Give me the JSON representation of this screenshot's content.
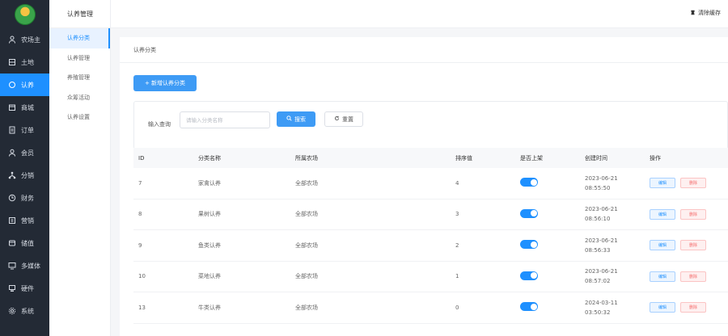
{
  "sidebar": {
    "items": [
      {
        "label": "农场主",
        "icon": "farmer-icon",
        "active": false
      },
      {
        "label": "土地",
        "icon": "land-icon",
        "active": false
      },
      {
        "label": "认养",
        "icon": "adopt-icon",
        "active": true
      },
      {
        "label": "商城",
        "icon": "mall-icon",
        "active": false
      },
      {
        "label": "订单",
        "icon": "order-icon",
        "active": false
      },
      {
        "label": "会员",
        "icon": "member-icon",
        "active": false
      },
      {
        "label": "分销",
        "icon": "distribution-icon",
        "active": false
      },
      {
        "label": "财务",
        "icon": "finance-icon",
        "active": false
      },
      {
        "label": "营销",
        "icon": "marketing-icon",
        "active": false
      },
      {
        "label": "储值",
        "icon": "stored-value-icon",
        "active": false
      },
      {
        "label": "多媒体",
        "icon": "multimedia-icon",
        "active": false
      },
      {
        "label": "硬件",
        "icon": "hardware-icon",
        "active": false
      },
      {
        "label": "系统",
        "icon": "system-icon",
        "active": false
      }
    ]
  },
  "submenu": {
    "title": "认养管理",
    "items": [
      {
        "label": "认养分类",
        "active": true
      },
      {
        "label": "认养管理",
        "active": false
      },
      {
        "label": "养殖管理",
        "active": false
      },
      {
        "label": "众筹活动",
        "active": false
      },
      {
        "label": "认养设置",
        "active": false
      }
    ]
  },
  "header": {
    "clear_cache": "清除缓存"
  },
  "page": {
    "breadcrumb": "认养分类",
    "add_button": "+ 新增认养分类"
  },
  "search": {
    "label": "输入查询",
    "placeholder": "请输入分类名称",
    "search_button": "搜索",
    "reset_button": "重置"
  },
  "table": {
    "columns": [
      "ID",
      "分类名称",
      "所属农场",
      "排序值",
      "是否上架",
      "创建时间",
      "操作"
    ],
    "rows": [
      {
        "id": "7",
        "name": "家禽认养",
        "farm": "全部农场",
        "sort": "4",
        "on_shelf": true,
        "date": "2023-06-21",
        "time": "08:55:50"
      },
      {
        "id": "8",
        "name": "果树认养",
        "farm": "全部农场",
        "sort": "3",
        "on_shelf": true,
        "date": "2023-06-21",
        "time": "08:56:10"
      },
      {
        "id": "9",
        "name": "鱼类认养",
        "farm": "全部农场",
        "sort": "2",
        "on_shelf": true,
        "date": "2023-06-21",
        "time": "08:56:33"
      },
      {
        "id": "10",
        "name": "菜地认养",
        "farm": "全部农场",
        "sort": "1",
        "on_shelf": true,
        "date": "2023-06-21",
        "time": "08:57:02"
      },
      {
        "id": "13",
        "name": "牛类认养",
        "farm": "全部农场",
        "sort": "0",
        "on_shelf": true,
        "date": "2024-03-11",
        "time": "03:50:32"
      }
    ],
    "edit_label": "编辑",
    "delete_label": "删除"
  },
  "colors": {
    "sidebar_bg": "#232a35",
    "accent": "#1e90ff",
    "danger": "#f56c6c"
  }
}
